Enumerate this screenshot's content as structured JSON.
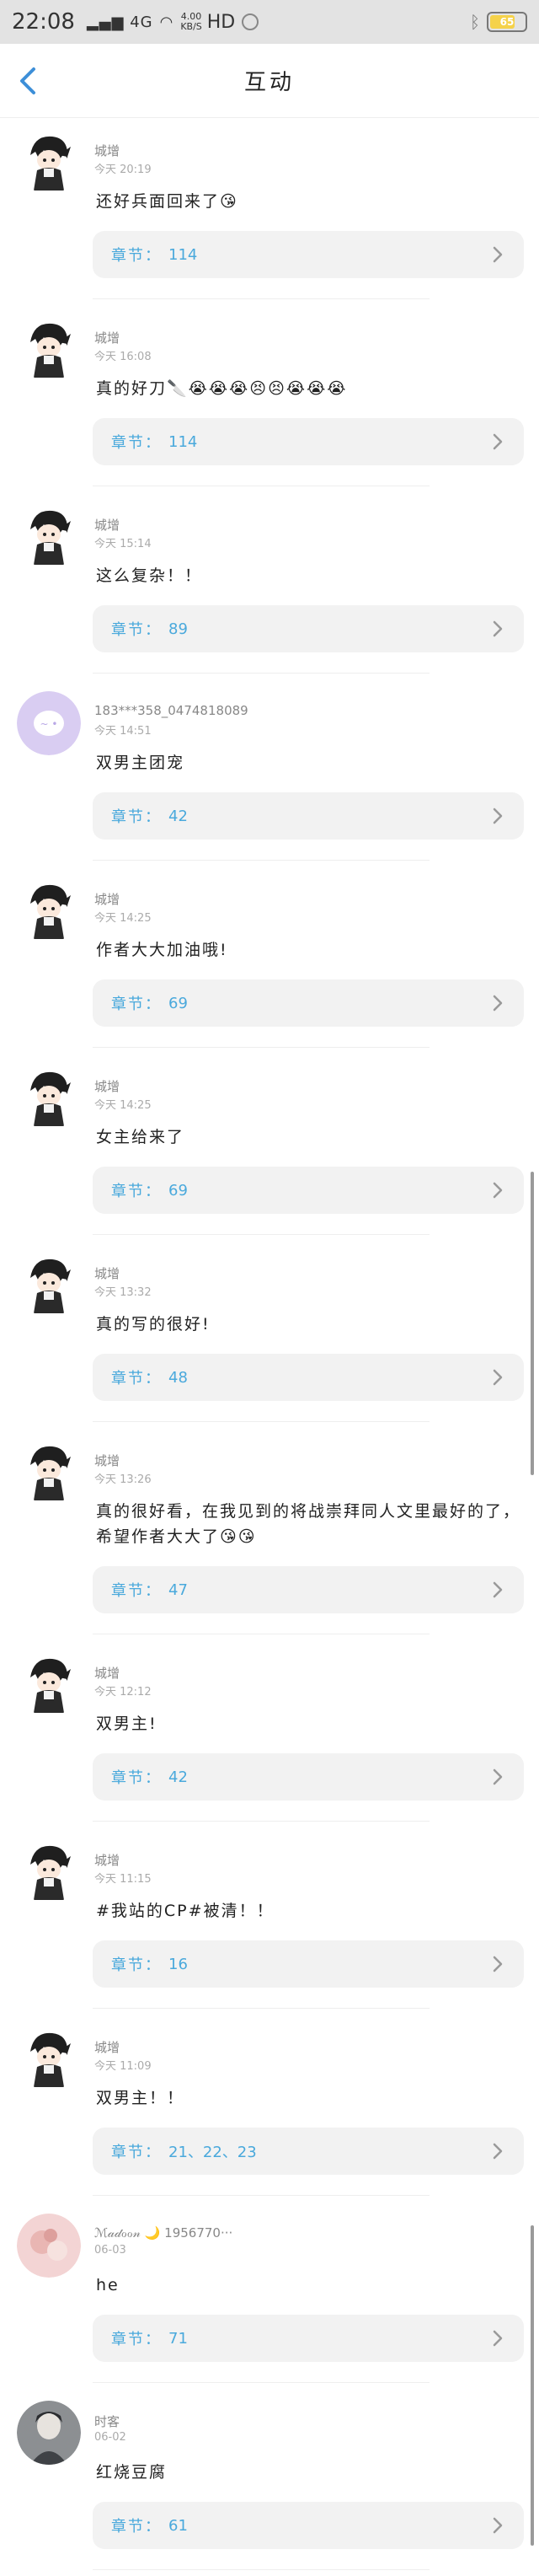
{
  "status_bar": {
    "time": "22:08",
    "signal": "4G",
    "network_speed_value": "4.00",
    "network_speed_unit": "KB/S",
    "hd_label": "HD",
    "battery": "65",
    "battery_level": 0.65
  },
  "header": {
    "title": "互动"
  },
  "chapter_label": "章节：",
  "comments": [
    {
      "name": "城增",
      "time": "今天 20:19",
      "text": "还好兵面回来了😘",
      "chapter": "114",
      "avatar": "anime-boy"
    },
    {
      "name": "城增",
      "time": "今天 16:08",
      "text": "真的好刀🔪😭😭😭😣😣😭😭😭",
      "chapter": "114",
      "avatar": "anime-boy"
    },
    {
      "name": "城增",
      "time": "今天 15:14",
      "text": "这么复杂！！",
      "chapter": "89",
      "avatar": "anime-boy"
    },
    {
      "name": "183***358_0474818089",
      "time": "今天 14:51",
      "text": "双男主团宠",
      "chapter": "42",
      "avatar": "default-purple"
    },
    {
      "name": "城增",
      "time": "今天 14:25",
      "text": "作者大大加油哦!",
      "chapter": "69",
      "avatar": "anime-boy"
    },
    {
      "name": "城增",
      "time": "今天 14:25",
      "text": "女主给来了",
      "chapter": "69",
      "avatar": "anime-boy"
    },
    {
      "name": "城增",
      "time": "今天 13:32",
      "text": "真的写的很好!",
      "chapter": "48",
      "avatar": "anime-boy"
    },
    {
      "name": "城增",
      "time": "今天 13:26",
      "text": "真的很好看，在我见到的将战崇拜同人文里最好的了，希望作者大大了😘😘",
      "chapter": "47",
      "avatar": "anime-boy"
    },
    {
      "name": "城增",
      "time": "今天 12:12",
      "text": "双男主!",
      "chapter": "42",
      "avatar": "anime-boy"
    },
    {
      "name": "城增",
      "time": "今天 11:15",
      "text": "#我站的CP#被清！！",
      "chapter": "16",
      "avatar": "anime-boy"
    },
    {
      "name": "城增",
      "time": "今天 11:09",
      "text": "双男主！！",
      "chapter": "21、22、23",
      "avatar": "anime-boy"
    },
    {
      "name": "ℳ𝒶𝒹ℴℴ𝓃 🌙 1956770···",
      "time": "06-03",
      "text": "he",
      "chapter": "71",
      "avatar": "pink-photo"
    },
    {
      "name": "时客",
      "time": "06-02",
      "text": "红烧豆腐",
      "chapter": "61",
      "avatar": "gray-photo"
    }
  ]
}
